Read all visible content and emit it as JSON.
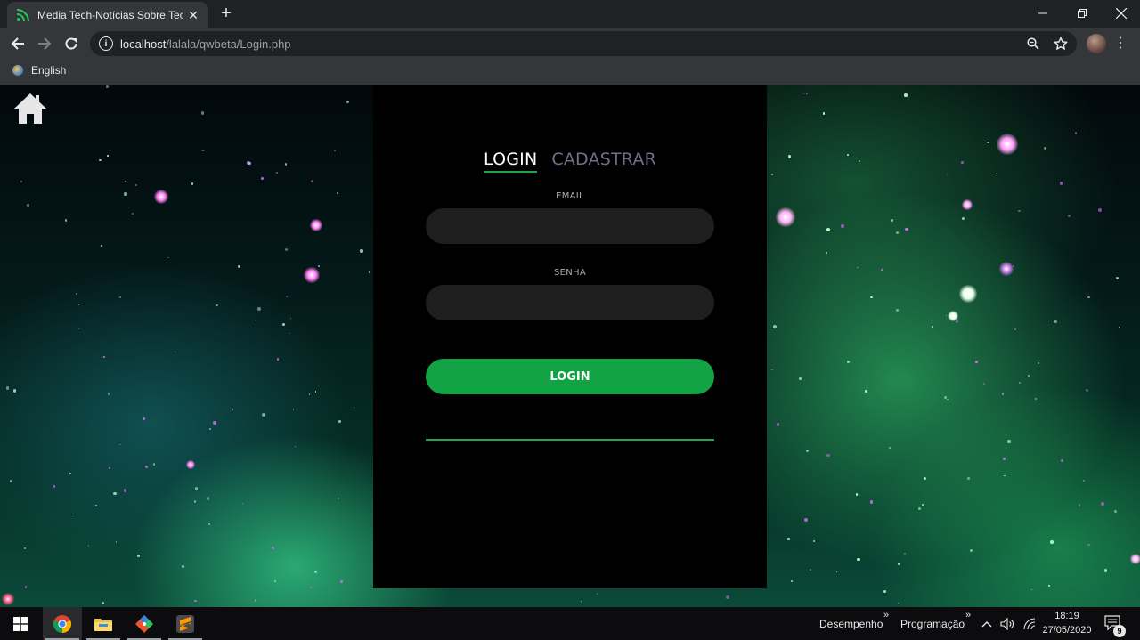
{
  "browser": {
    "tab_title": "Media Tech-Notícias Sobre Tecno",
    "url_host": "localhost",
    "url_path": "/lalala/qwbeta/Login.php",
    "bookmark_label": "English"
  },
  "login_panel": {
    "tab_login": "LOGIN",
    "tab_register": "CADASTRAR",
    "email_label": "EMAIL",
    "password_label": "SENHA",
    "email_value": "",
    "password_value": "",
    "submit_label": "LOGIN"
  },
  "taskbar": {
    "toolbar_1": "Desempenho",
    "toolbar_2": "Programação",
    "time": "18:19",
    "date": "27/05/2020",
    "notification_count": "9"
  },
  "colors": {
    "accent_green": "#21a650",
    "button_green": "#10a243",
    "panel_bg": "#000000",
    "input_bg": "#1e1e1e",
    "inactive_tab": "#6f6f8a"
  }
}
